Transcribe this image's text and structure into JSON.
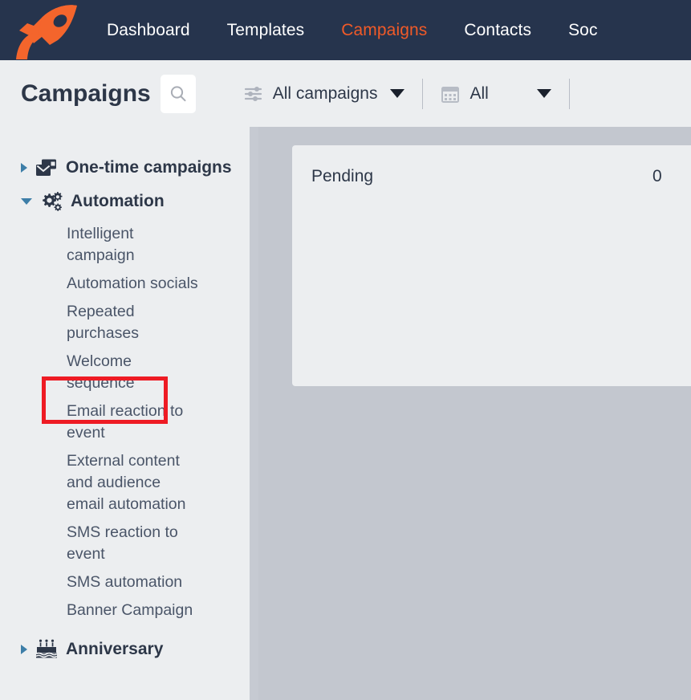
{
  "topnav": {
    "logo_name": "rocket-logo",
    "brand_color": "#f05a28",
    "background": "#26344d",
    "links": [
      {
        "label": "Dashboard",
        "active": false
      },
      {
        "label": "Templates",
        "active": false
      },
      {
        "label": "Campaigns",
        "active": true
      },
      {
        "label": "Contacts",
        "active": false
      },
      {
        "label": "Soc",
        "active": false
      }
    ]
  },
  "subheader": {
    "title": "Campaigns",
    "search_icon": "search-icon",
    "filters": [
      {
        "icon": "sliders-icon",
        "label": "All campaigns",
        "caret": "chevron-down-icon"
      },
      {
        "icon": "calendar-icon",
        "label": "All",
        "caret": "chevron-down-icon"
      }
    ]
  },
  "sidebar": {
    "groups": [
      {
        "label": "One-time campaigns",
        "icon": "envelope-card-icon",
        "expanded": false,
        "items": []
      },
      {
        "label": "Automation",
        "icon": "gears-icon",
        "expanded": true,
        "items": [
          "Intelligent campaign",
          "Automation socials",
          "Repeated purchases",
          "Welcome sequence",
          "Email reaction to event",
          "External content and audience email automation",
          "SMS reaction to event",
          "SMS automation",
          "Banner Campaign"
        ]
      },
      {
        "label": "Anniversary",
        "icon": "birthday-cake-icon",
        "expanded": false,
        "items": []
      }
    ],
    "highlighted_item": "Welcome sequence",
    "highlight_color": "#ee1b24"
  },
  "content": {
    "card": {
      "label": "Pending",
      "value": "0"
    }
  }
}
